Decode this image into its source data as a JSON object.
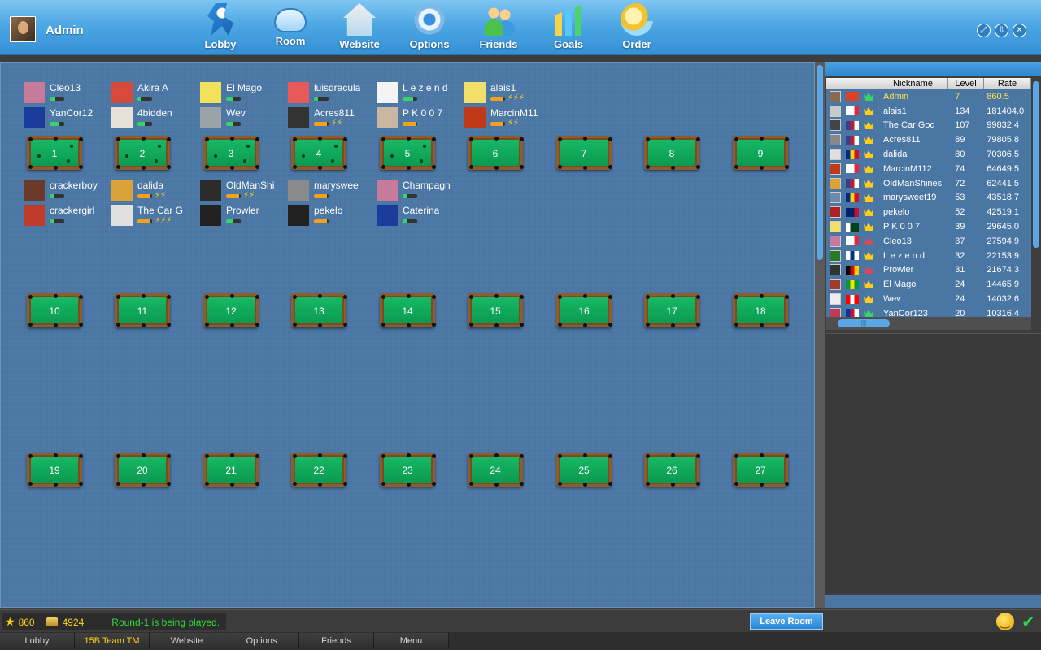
{
  "header": {
    "username": "Admin",
    "nav": [
      {
        "label": "Lobby",
        "icon": "runner-icon"
      },
      {
        "label": "Room",
        "icon": "gamepad-icon"
      },
      {
        "label": "Website",
        "icon": "house-icon"
      },
      {
        "label": "Options",
        "icon": "gear-icon"
      },
      {
        "label": "Friends",
        "icon": "friends-icon"
      },
      {
        "label": "Goals",
        "icon": "bar-chart-icon"
      },
      {
        "label": "Order",
        "icon": "diamond-icon"
      }
    ],
    "window_controls": [
      "restore-icon",
      "minimize-icon",
      "close-icon"
    ]
  },
  "tables": [
    {
      "number": "1",
      "occupied": true,
      "players": [
        {
          "name": "Cleo13",
          "level": 0.4,
          "bolts": ""
        },
        {
          "name": "YanCor12",
          "level": 0.6,
          "bolts": ""
        }
      ]
    },
    {
      "number": "2",
      "occupied": true,
      "players": [
        {
          "name": "Akira A",
          "level": 0.2,
          "bolts": ""
        },
        {
          "name": "4bidden",
          "level": 0.5,
          "bolts": ""
        }
      ]
    },
    {
      "number": "3",
      "occupied": true,
      "players": [
        {
          "name": "El Mago",
          "level": 0.5,
          "bolts": ""
        },
        {
          "name": "Wev",
          "level": 0.5,
          "bolts": ""
        }
      ]
    },
    {
      "number": "4",
      "occupied": true,
      "players": [
        {
          "name": "luisdracula",
          "level": 0.3,
          "bolts": ""
        },
        {
          "name": "Acres811",
          "level": 0.9,
          "bolts": "⚡⚡"
        }
      ]
    },
    {
      "number": "5",
      "occupied": true,
      "players": [
        {
          "name": "L e z e n d",
          "level": 0.7,
          "bolts": ""
        },
        {
          "name": "P K 0 0 7",
          "level": 0.9,
          "bolts": ""
        }
      ]
    },
    {
      "number": "6",
      "occupied": false,
      "players": [
        {
          "name": "alais1",
          "level": 0.9,
          "bolts": "⚡⚡⚡"
        },
        {
          "name": "MarcinM11",
          "level": 0.9,
          "bolts": "⚡⚡"
        }
      ]
    },
    {
      "number": "7",
      "occupied": false,
      "players": []
    },
    {
      "number": "8",
      "occupied": false,
      "players": []
    },
    {
      "number": "9",
      "occupied": false,
      "players": []
    },
    {
      "number": "10",
      "occupied": false,
      "players": [
        {
          "name": "crackerboy",
          "level": 0.3,
          "bolts": ""
        },
        {
          "name": "crackergirl",
          "level": 0.3,
          "bolts": ""
        }
      ]
    },
    {
      "number": "11",
      "occupied": false,
      "players": [
        {
          "name": "dalida",
          "level": 0.9,
          "bolts": "⚡⚡"
        },
        {
          "name": "The Car G",
          "level": 0.9,
          "bolts": "⚡⚡⚡"
        }
      ]
    },
    {
      "number": "12",
      "occupied": false,
      "players": [
        {
          "name": "OldManShi",
          "level": 0.9,
          "bolts": "⚡⚡"
        },
        {
          "name": "Prowler",
          "level": 0.5,
          "bolts": ""
        }
      ]
    },
    {
      "number": "13",
      "occupied": false,
      "players": [
        {
          "name": "maryswee",
          "level": 0.9,
          "bolts": ""
        },
        {
          "name": "pekelo",
          "level": 0.9,
          "bolts": ""
        }
      ]
    },
    {
      "number": "14",
      "occupied": false,
      "players": [
        {
          "name": "Champagn",
          "level": 0.3,
          "bolts": ""
        },
        {
          "name": "Caterina",
          "level": 0.3,
          "bolts": ""
        }
      ]
    },
    {
      "number": "15",
      "occupied": false,
      "players": []
    },
    {
      "number": "16",
      "occupied": false,
      "players": []
    },
    {
      "number": "17",
      "occupied": false,
      "players": []
    },
    {
      "number": "18",
      "occupied": false,
      "players": []
    },
    {
      "number": "19",
      "occupied": false,
      "players": []
    },
    {
      "number": "20",
      "occupied": false,
      "players": []
    },
    {
      "number": "21",
      "occupied": false,
      "players": []
    },
    {
      "number": "22",
      "occupied": false,
      "players": []
    },
    {
      "number": "23",
      "occupied": false,
      "players": []
    },
    {
      "number": "24",
      "occupied": false,
      "players": []
    },
    {
      "number": "25",
      "occupied": false,
      "players": []
    },
    {
      "number": "26",
      "occupied": false,
      "players": []
    },
    {
      "number": "27",
      "occupied": false,
      "players": []
    }
  ],
  "ranking": {
    "columns": [
      "Nickname",
      "Level",
      "Rate"
    ],
    "rows": [
      {
        "nickname": "Admin",
        "level": "7",
        "rate": "860.5",
        "me": true,
        "flag": [
          "#d9412b",
          "#d9412b",
          "#d9412b"
        ],
        "rank_color": "#3ad36b"
      },
      {
        "nickname": "alais1",
        "level": "134",
        "rate": "181404.0",
        "flag": [
          "#ffffff",
          "#ffffff",
          "#e0283e"
        ],
        "rank_color": "#ffcc1a"
      },
      {
        "nickname": "The Car God",
        "level": "107",
        "rate": "99832.4",
        "flag": [
          "#3c3b8e",
          "#b22234",
          "#ffffff"
        ],
        "rank_color": "#ffcc1a"
      },
      {
        "nickname": "Acres811",
        "level": "89",
        "rate": "79805.8",
        "flag": [
          "#3c3b8e",
          "#b22234",
          "#ffffff"
        ],
        "rank_color": "#ffcc1a"
      },
      {
        "nickname": "dalida",
        "level": "80",
        "rate": "70306.5",
        "flag": [
          "#002b7f",
          "#fcd116",
          "#ce1126"
        ],
        "rank_color": "#ffcc1a"
      },
      {
        "nickname": "MarcinM112",
        "level": "74",
        "rate": "64649.5",
        "flag": [
          "#ffffff",
          "#ffffff",
          "#e0283e"
        ],
        "rank_color": "#ffcc1a"
      },
      {
        "nickname": "OldManShines",
        "level": "72",
        "rate": "62441.5",
        "flag": [
          "#3c3b8e",
          "#b22234",
          "#ffffff"
        ],
        "rank_color": "#ffcc1a"
      },
      {
        "nickname": "marysweet19",
        "level": "53",
        "rate": "43518.7",
        "flag": [
          "#002b7f",
          "#fcd116",
          "#ce1126"
        ],
        "rank_color": "#ffcc1a"
      },
      {
        "nickname": "pekelo",
        "level": "52",
        "rate": "42519.1",
        "flag": [
          "#012169",
          "#012169",
          "#c8102e"
        ],
        "rank_color": "#ffcc1a"
      },
      {
        "nickname": "P K 0 0 7",
        "level": "39",
        "rate": "29645.0",
        "flag": [
          "#ffffff",
          "#01411c",
          "#01411c"
        ],
        "rank_color": "#ffcc1a"
      },
      {
        "nickname": "Cleo13",
        "level": "37",
        "rate": "27594.9",
        "flag": [
          "#ffffff",
          "#ffffff",
          "#e0283e"
        ],
        "rank_color": "#e0455a"
      },
      {
        "nickname": "L e z e n d",
        "level": "32",
        "rate": "22153.9",
        "flag": [
          "#ffffff",
          "#003580",
          "#ffffff"
        ],
        "rank_color": "#ffcc1a"
      },
      {
        "nickname": "Prowler",
        "level": "31",
        "rate": "21674.3",
        "flag": [
          "#000000",
          "#dd0000",
          "#ffce00"
        ],
        "rank_color": "#e0455a"
      },
      {
        "nickname": "El Mago",
        "level": "24",
        "rate": "14465.9",
        "flag": [
          "#009c3b",
          "#ffdf00",
          "#009c3b"
        ],
        "rank_color": "#ffcc1a"
      },
      {
        "nickname": "Wev",
        "level": "24",
        "rate": "14032.6",
        "flag": [
          "#ff0000",
          "#ffffff",
          "#ff0000"
        ],
        "rank_color": "#ffcc1a"
      },
      {
        "nickname": "YanCor123",
        "level": "20",
        "rate": "10316.4",
        "flag": [
          "#0038a8",
          "#ce1126",
          "#ffffff"
        ],
        "rank_color": "#3ad36b"
      }
    ]
  },
  "status": {
    "stars": "860",
    "coins": "4924",
    "message": "Round-1 is being played."
  },
  "actions": {
    "leave_room": "Leave Room"
  },
  "bottom_tabs": [
    {
      "label": "Lobby",
      "active": false
    },
    {
      "label": "15B Team TM",
      "active": true
    },
    {
      "label": "Website",
      "active": false
    },
    {
      "label": "Options",
      "active": false
    },
    {
      "label": "Friends",
      "active": false
    },
    {
      "label": "Menu",
      "active": false
    }
  ],
  "colors": {
    "felt": "#12aa5a",
    "level_bar": "#3ad36b",
    "level_bar_high": "#f2a11c",
    "accent_blue": "#2b86d4",
    "status_green": "#2ddc3a",
    "gold": "#ffd21a"
  }
}
